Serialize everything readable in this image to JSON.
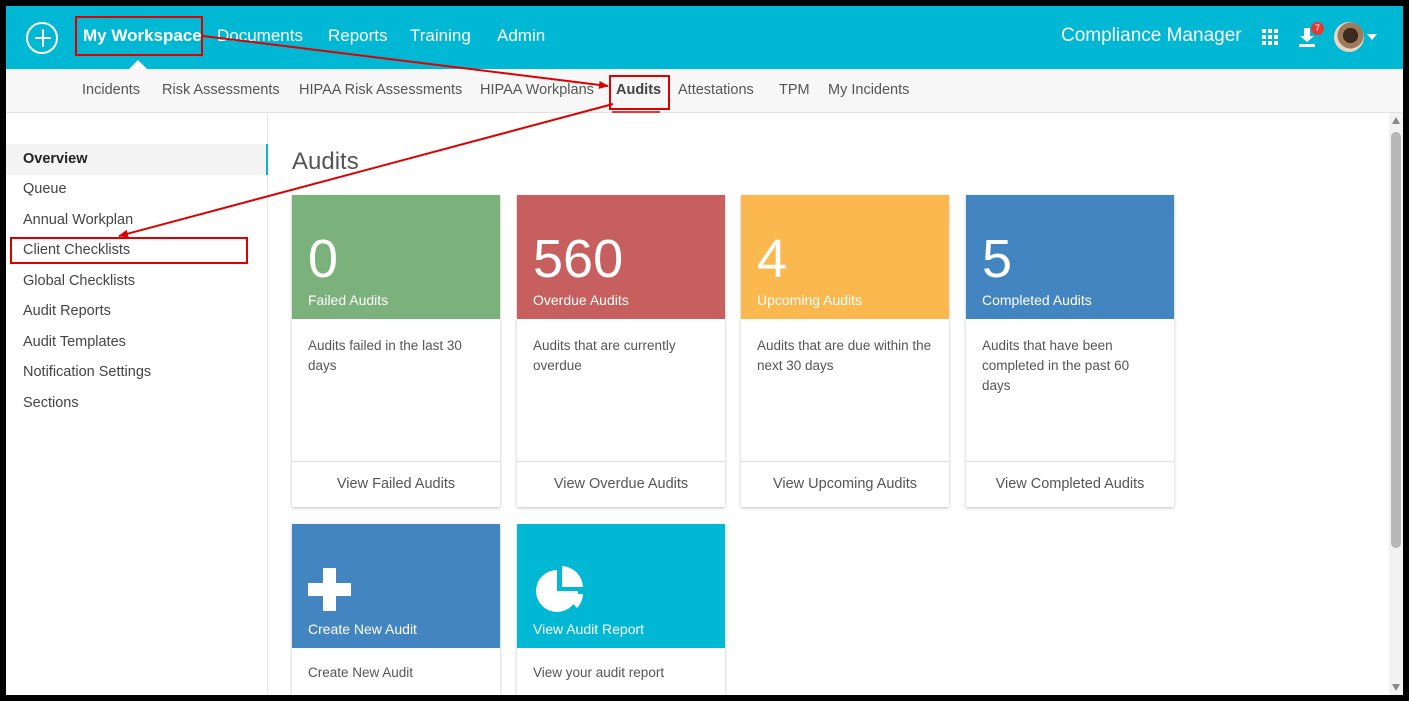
{
  "topnav": {
    "items": [
      "My Workspace",
      "Documents",
      "Reports",
      "Training",
      "Admin"
    ],
    "active": "My Workspace",
    "brand": "Compliance Manager",
    "download_badge": "7"
  },
  "subnav": {
    "items": [
      "Incidents",
      "Risk Assessments",
      "HIPAA Risk Assessments",
      "HIPAA Workplans",
      "Audits",
      "Attestations",
      "TPM",
      "My Incidents"
    ],
    "active": "Audits"
  },
  "sidebar": {
    "items": [
      "Overview",
      "Queue",
      "Annual Workplan",
      "Client Checklists",
      "Global Checklists",
      "Audit Reports",
      "Audit Templates",
      "Notification Settings",
      "Sections"
    ],
    "active": "Overview"
  },
  "main": {
    "title": "Audits",
    "cards": [
      {
        "number": "0",
        "label": "Failed Audits",
        "description": "Audits failed in the last 30 days",
        "link": "View Failed Audits",
        "color": "#7bb17b"
      },
      {
        "number": "560",
        "label": "Overdue Audits",
        "description": "Audits that are currently overdue",
        "link": "View Overdue Audits",
        "color": "#c65f5d"
      },
      {
        "number": "4",
        "label": "Upcoming Audits",
        "description": "Audits that are due within the next 30 days",
        "link": "View Upcoming Audits",
        "color": "#fbb84e"
      },
      {
        "number": "5",
        "label": "Completed Audits",
        "description": "Audits that have been completed in the past 60 days",
        "link": "View Completed Audits",
        "color": "#4285c0"
      }
    ],
    "action_cards": [
      {
        "label": "Create New Audit",
        "description": "Create New Audit",
        "icon": "plus-icon",
        "color": "#4285c0"
      },
      {
        "label": "View Audit Report",
        "description": "View your audit report",
        "icon": "pie-chart-icon",
        "color": "#00b8d4"
      }
    ]
  },
  "colors": {
    "topbar": "#00b8d4",
    "annotation": "#dd0000",
    "active_underline": "#e53935"
  }
}
